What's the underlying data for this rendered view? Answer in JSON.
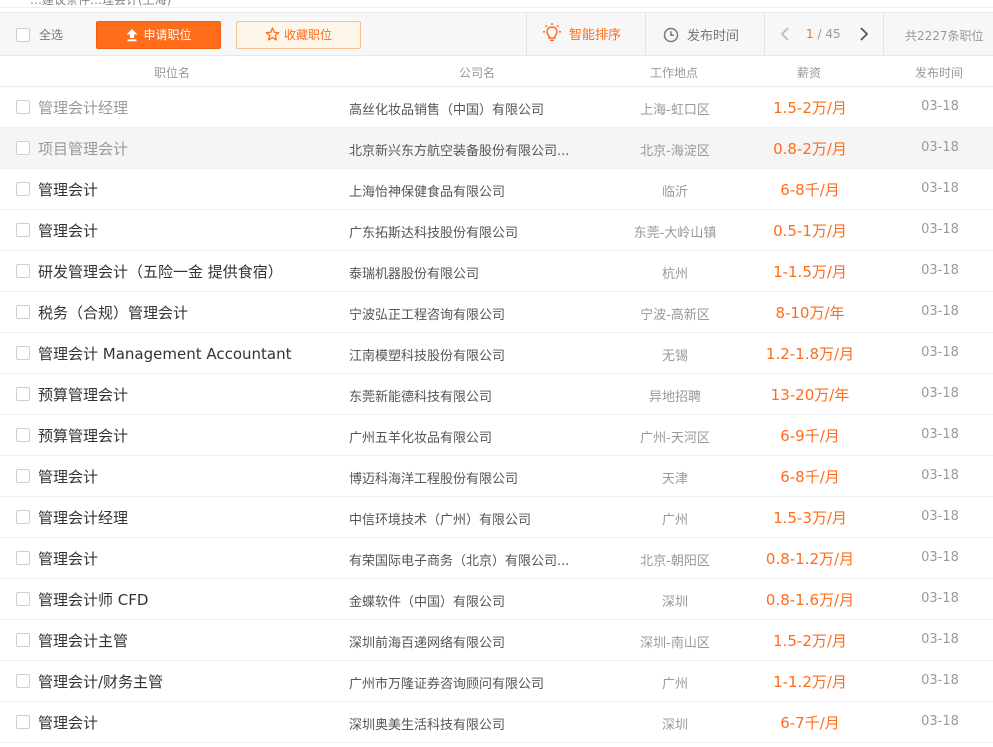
{
  "breadcrumb": {
    "left": "…建议条件",
    "right": "…理会计(上海)"
  },
  "toolbar": {
    "select_all": "全选",
    "apply_label": "申请职位",
    "favorite_label": "收藏职位",
    "sort_smart_label": "智能排序",
    "sort_time_label": "发布时间",
    "pager_current": "1",
    "pager_total": "/ 45",
    "total_label": "共2227条职位"
  },
  "columns": {
    "title": "职位名",
    "company": "公司名",
    "location": "工作地点",
    "salary": "薪资",
    "date": "发布时间"
  },
  "colors": {
    "accent": "#ff6c1a",
    "visited_text": "#999999"
  },
  "jobs": [
    {
      "title": "管理会计经理",
      "company": "高丝化妆品销售（中国）有限公司",
      "location": "上海-虹口区",
      "salary": "1.5-2万/月",
      "date": "03-18"
    },
    {
      "title": "项目管理会计",
      "company": "北京新兴东方航空装备股份有限公司...",
      "location": "北京-海淀区",
      "salary": "0.8-2万/月",
      "date": "03-18"
    },
    {
      "title": "管理会计",
      "company": "上海怡神保健食品有限公司",
      "location": "临沂",
      "salary": "6-8千/月",
      "date": "03-18"
    },
    {
      "title": "管理会计",
      "company": "广东拓斯达科技股份有限公司",
      "location": "东莞-大岭山镇",
      "salary": "0.5-1万/月",
      "date": "03-18"
    },
    {
      "title": "研发管理会计（五险一金 提供食宿）",
      "company": "泰瑞机器股份有限公司",
      "location": "杭州",
      "salary": "1-1.5万/月",
      "date": "03-18"
    },
    {
      "title": "税务（合规）管理会计",
      "company": "宁波弘正工程咨询有限公司",
      "location": "宁波-高新区",
      "salary": "8-10万/年",
      "date": "03-18"
    },
    {
      "title": "管理会计 Management Accountant",
      "company": "江南模塑科技股份有限公司",
      "location": "无锡",
      "salary": "1.2-1.8万/月",
      "date": "03-18"
    },
    {
      "title": "预算管理会计",
      "company": "东莞新能德科技有限公司",
      "location": "异地招聘",
      "salary": "13-20万/年",
      "date": "03-18"
    },
    {
      "title": "预算管理会计",
      "company": "广州五羊化妆品有限公司",
      "location": "广州-天河区",
      "salary": "6-9千/月",
      "date": "03-18"
    },
    {
      "title": "管理会计",
      "company": "博迈科海洋工程股份有限公司",
      "location": "天津",
      "salary": "6-8千/月",
      "date": "03-18"
    },
    {
      "title": "管理会计经理",
      "company": "中信环境技术（广州）有限公司",
      "location": "广州",
      "salary": "1.5-3万/月",
      "date": "03-18"
    },
    {
      "title": "管理会计",
      "company": "有荣国际电子商务（北京）有限公司...",
      "location": "北京-朝阳区",
      "salary": "0.8-1.2万/月",
      "date": "03-18"
    },
    {
      "title": "管理会计师 CFD",
      "company": "金蝶软件（中国）有限公司",
      "location": "深圳",
      "salary": "0.8-1.6万/月",
      "date": "03-18"
    },
    {
      "title": "管理会计主管",
      "company": "深圳前海百递网络有限公司",
      "location": "深圳-南山区",
      "salary": "1.5-2万/月",
      "date": "03-18"
    },
    {
      "title": "管理会计/财务主管",
      "company": "广州市万隆证券咨询顾问有限公司",
      "location": "广州",
      "salary": "1-1.2万/月",
      "date": "03-18"
    },
    {
      "title": "管理会计",
      "company": "深圳奥美生活科技有限公司",
      "location": "深圳",
      "salary": "6-7千/月",
      "date": "03-18"
    }
  ]
}
